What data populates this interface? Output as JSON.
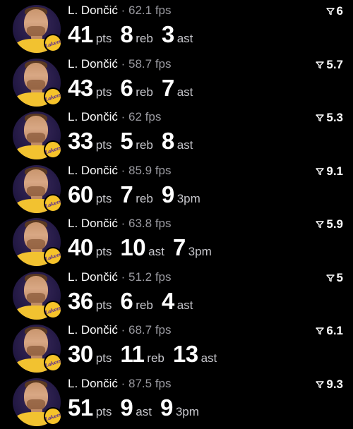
{
  "feed": {
    "entries": [
      {
        "player": "L. Dončić",
        "separator": "·",
        "fps": "62.1 fps",
        "rating": "6",
        "stats": [
          {
            "value": "41",
            "label": "pts"
          },
          {
            "value": "8",
            "label": "reb"
          },
          {
            "value": "3",
            "label": "ast"
          }
        ]
      },
      {
        "player": "L. Dončić",
        "separator": "·",
        "fps": "58.7 fps",
        "rating": "5.7",
        "stats": [
          {
            "value": "43",
            "label": "pts"
          },
          {
            "value": "6",
            "label": "reb"
          },
          {
            "value": "7",
            "label": "ast"
          }
        ]
      },
      {
        "player": "L. Dončić",
        "separator": "·",
        "fps": "62 fps",
        "rating": "5.3",
        "stats": [
          {
            "value": "33",
            "label": "pts"
          },
          {
            "value": "5",
            "label": "reb"
          },
          {
            "value": "8",
            "label": "ast"
          }
        ]
      },
      {
        "player": "L. Dončić",
        "separator": "·",
        "fps": "85.9 fps",
        "rating": "9.1",
        "stats": [
          {
            "value": "60",
            "label": "pts"
          },
          {
            "value": "7",
            "label": "reb"
          },
          {
            "value": "9",
            "label": "3pm"
          }
        ]
      },
      {
        "player": "L. Dončić",
        "separator": "·",
        "fps": "63.8 fps",
        "rating": "5.9",
        "stats": [
          {
            "value": "40",
            "label": "pts"
          },
          {
            "value": "10",
            "label": "ast"
          },
          {
            "value": "7",
            "label": "3pm"
          }
        ]
      },
      {
        "player": "L. Dončić",
        "separator": "·",
        "fps": "51.2 fps",
        "rating": "5",
        "stats": [
          {
            "value": "36",
            "label": "pts"
          },
          {
            "value": "6",
            "label": "reb"
          },
          {
            "value": "4",
            "label": "ast"
          }
        ]
      },
      {
        "player": "L. Dončić",
        "separator": "·",
        "fps": "68.7 fps",
        "rating": "6.1",
        "stats": [
          {
            "value": "30",
            "label": "pts"
          },
          {
            "value": "11",
            "label": "reb"
          },
          {
            "value": "13",
            "label": "ast"
          }
        ]
      },
      {
        "player": "L. Dončić",
        "separator": "·",
        "fps": "87.5 fps",
        "rating": "9.3",
        "stats": [
          {
            "value": "51",
            "label": "pts"
          },
          {
            "value": "9",
            "label": "ast"
          },
          {
            "value": "9",
            "label": "3pm"
          }
        ]
      }
    ]
  },
  "icons": {
    "avatar": "player-headshot-icon",
    "team": "lakers-logo-icon",
    "rating": "filter-funnel-icon"
  },
  "colors": {
    "background": "#000000",
    "text": "#ffffff",
    "muted": "#9a9aa0",
    "team_gold": "#f6c32a",
    "team_purple": "#5a2b91"
  }
}
